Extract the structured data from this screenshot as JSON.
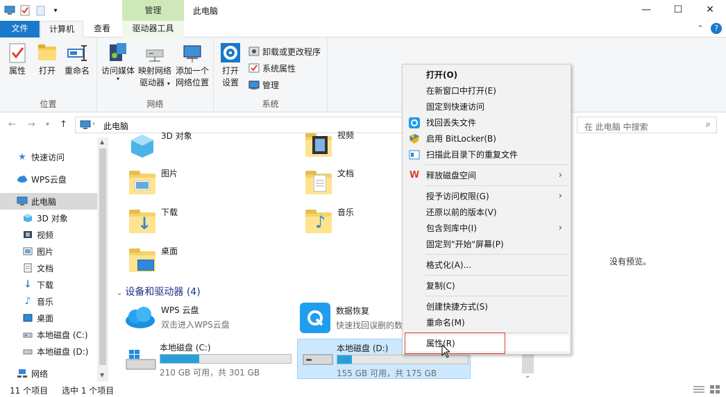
{
  "window": {
    "title": "此电脑",
    "context_tab": "管理",
    "min": "—",
    "max": "☐",
    "close": "✕"
  },
  "tabs": {
    "file": "文件",
    "computer": "计算机",
    "view": "查看",
    "drive_tools": "驱动器工具"
  },
  "ribbon": {
    "location": {
      "label": "位置",
      "properties": "属性",
      "open": "打开",
      "rename": "重命名"
    },
    "network": {
      "label": "网络",
      "access_media": "访问媒体",
      "map_drive_1": "映射网络",
      "map_drive_2": "驱动器",
      "add_location_1": "添加一个",
      "add_location_2": "网络位置"
    },
    "system": {
      "label": "系统",
      "open_settings_1": "打开",
      "open_settings_2": "设置",
      "uninstall": "卸载或更改程序",
      "sys_props": "系统属性",
      "manage": "管理"
    }
  },
  "nav": {
    "address": "此电脑",
    "search_placeholder": "在 此电脑 中搜索"
  },
  "sidebar": {
    "items": [
      {
        "label": "快速访问"
      },
      {
        "label": "WPS云盘"
      },
      {
        "label": "此电脑"
      },
      {
        "label": "3D 对象"
      },
      {
        "label": "视频"
      },
      {
        "label": "图片"
      },
      {
        "label": "文档"
      },
      {
        "label": "下载"
      },
      {
        "label": "音乐"
      },
      {
        "label": "桌面"
      },
      {
        "label": "本地磁盘 (C:)"
      },
      {
        "label": "本地磁盘 (D:)"
      },
      {
        "label": "网络"
      }
    ]
  },
  "folders": {
    "objects3d": "3D 对象",
    "videos": "视频",
    "pictures": "图片",
    "documents": "文档",
    "downloads": "下载",
    "music": "音乐",
    "desktop": "桌面"
  },
  "devices": {
    "header": "设备和驱动器 (4)",
    "wps_name": "WPS 云盘",
    "wps_desc": "双击进入WPS云盘",
    "recovery_name": "数据恢复",
    "recovery_desc": "快速找回误删的数",
    "c_name": "本地磁盘 (C:)",
    "c_info": "210 GB 可用，共 301 GB",
    "c_used": 0.3,
    "d_name": "本地磁盘 (D:)",
    "d_info": "155 GB 可用，共 175 GB",
    "d_used": 0.11
  },
  "preview": {
    "text": "没有预览。"
  },
  "status": {
    "count": "11 个项目",
    "selected": "选中 1 个项目"
  },
  "context_menu": {
    "open": "打开(O)",
    "open_new_window": "在新窗口中打开(E)",
    "pin_quick": "固定到快速访问",
    "recover_files": "找回丢失文件",
    "bitlocker": "启用 BitLocker(B)",
    "scan_duplicates": "扫描此目录下的重复文件",
    "free_space": "释放磁盘空间",
    "grant_access": "授予访问权限(G)",
    "restore_versions": "还原以前的版本(V)",
    "include_library": "包含到库中(I)",
    "pin_start": "固定到\"开始\"屏幕(P)",
    "format": "格式化(A)...",
    "copy": "复制(C)",
    "create_shortcut": "创建快捷方式(S)",
    "rename": "重命名(M)",
    "properties": "属性(R)"
  },
  "colors": {
    "accent": "#1979ca",
    "drive_fill": "#26a0da",
    "highlight": "#e03c3c",
    "selection": "#cce8ff"
  }
}
